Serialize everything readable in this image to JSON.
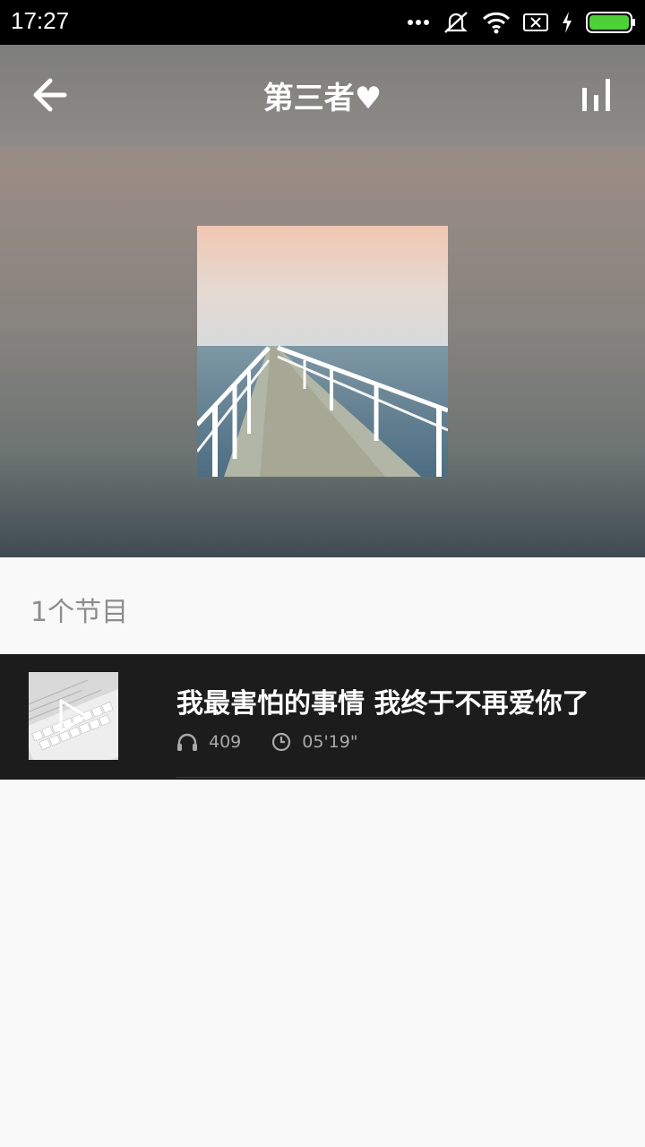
{
  "status_bar": {
    "time": "17:27",
    "icons": [
      "more-dots-icon",
      "mute-icon",
      "wifi-icon",
      "sim-none-icon",
      "charging-icon",
      "battery-icon"
    ]
  },
  "header": {
    "title": "第三者♥"
  },
  "list": {
    "count_label": "1个节目",
    "items": [
      {
        "title": "我最害怕的事情 我终于不再爱你了",
        "plays": "409",
        "duration": "05'19\""
      }
    ]
  },
  "colors": {
    "accent_green": "#4cd137",
    "dark_row": "#1c1c1c"
  }
}
